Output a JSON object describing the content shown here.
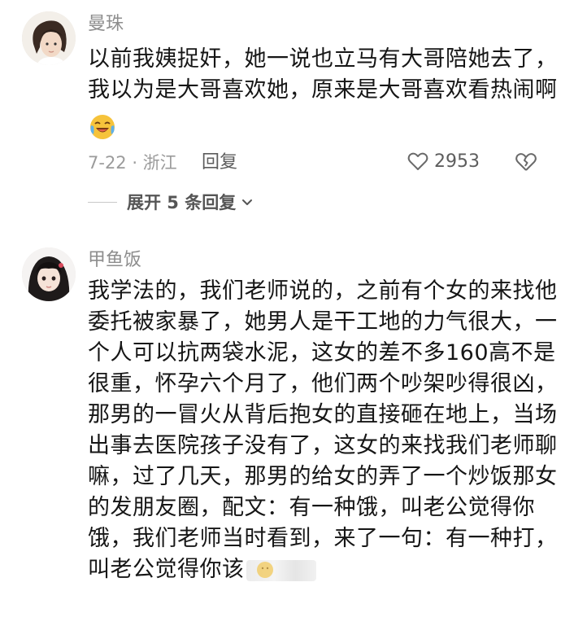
{
  "comments": [
    {
      "username": "曼珠",
      "lines": [
        "以前我姨捉奸，她一说也立马有大哥陪她去了，",
        "我以为是大哥喜欢她，原来是大哥喜欢看热闹啊"
      ],
      "emoji": "laughing-crying-emoji",
      "date_location": "7-22 · 浙江",
      "reply_label": "回复",
      "like_count": "2953",
      "expand_label": "展开 5 条回复"
    },
    {
      "username": "甲鱼饭",
      "lines": [
        "我学法的，我们老师说的，之前有个女的来找他",
        "委托被家暴了，她男人是干工地的力气很大，一",
        "个人可以抗两袋水泥，这女的差不多160高不是",
        "很重，怀孕六个月了，他们两个吵架吵得很凶，",
        "那男的一冒火从背后抱女的直接砸在地上，当场",
        "出事去医院孩子没有了，这女的来找我们老师聊",
        "嘛，过了几天，那男的给女的弄了一个炒饭那女",
        "的发朋友圈，配文：有一种饿，叫老公觉得你",
        "饿，我们老师当时看到，来了一句：有一种打，",
        "叫老公觉得你该"
      ]
    }
  ],
  "colors": {
    "username": "#8d8d8d",
    "body_text": "#161616",
    "meta": "#9b9b9b"
  }
}
